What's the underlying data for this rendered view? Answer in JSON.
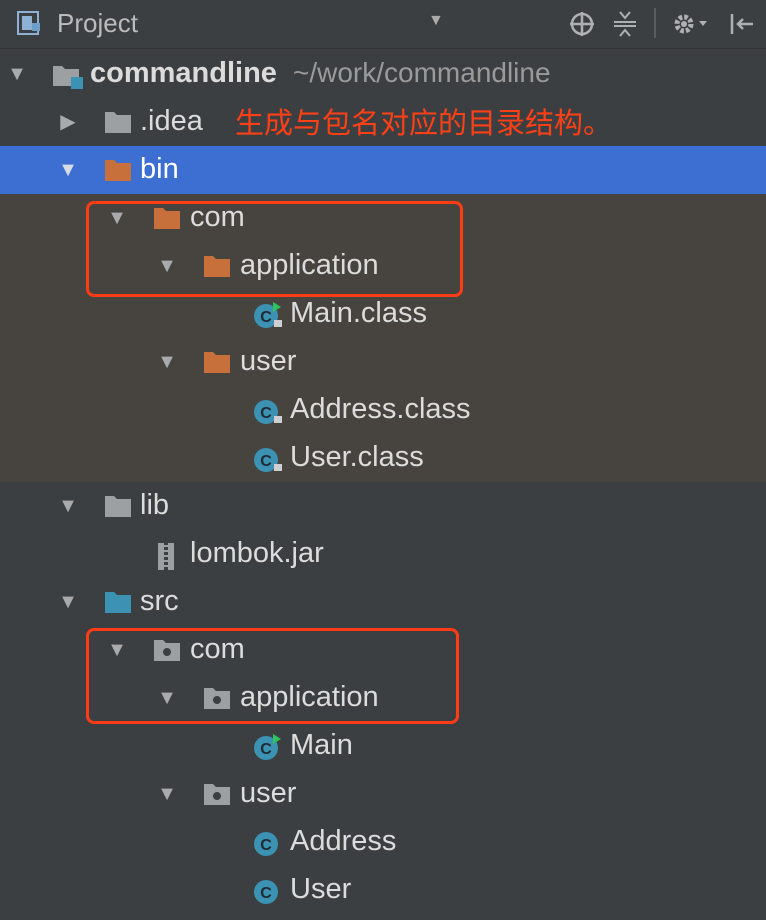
{
  "panel": {
    "title": "Project"
  },
  "annotation": {
    "text": "生成与包名对应的目录结构。"
  },
  "tree": {
    "root": {
      "name": "commandline",
      "path": "~/work/commandline"
    },
    "idea": ".idea",
    "bin": {
      "name": "bin",
      "com": "com",
      "application": "application",
      "main_class": "Main.class",
      "user": "user",
      "address_class": "Address.class",
      "user_class": "User.class"
    },
    "lib": {
      "name": "lib",
      "jar": "lombok.jar"
    },
    "src": {
      "name": "src",
      "com": "com",
      "application": "application",
      "main": "Main",
      "user": "user",
      "address": "Address",
      "user_cls": "User"
    }
  },
  "colors": {
    "background": "#3c3f41",
    "selection": "#3d6fd3",
    "excluded_band": "#47443f",
    "excluded_folder": "#c8703c",
    "source_folder": "#3b92b3",
    "annotation_red": "#ff4017"
  },
  "icons": [
    "project-icon",
    "locate-icon",
    "collapse-all-icon",
    "gear-icon",
    "hide-panel-icon",
    "folder-icon",
    "package-icon",
    "class-icon",
    "jar-icon"
  ]
}
